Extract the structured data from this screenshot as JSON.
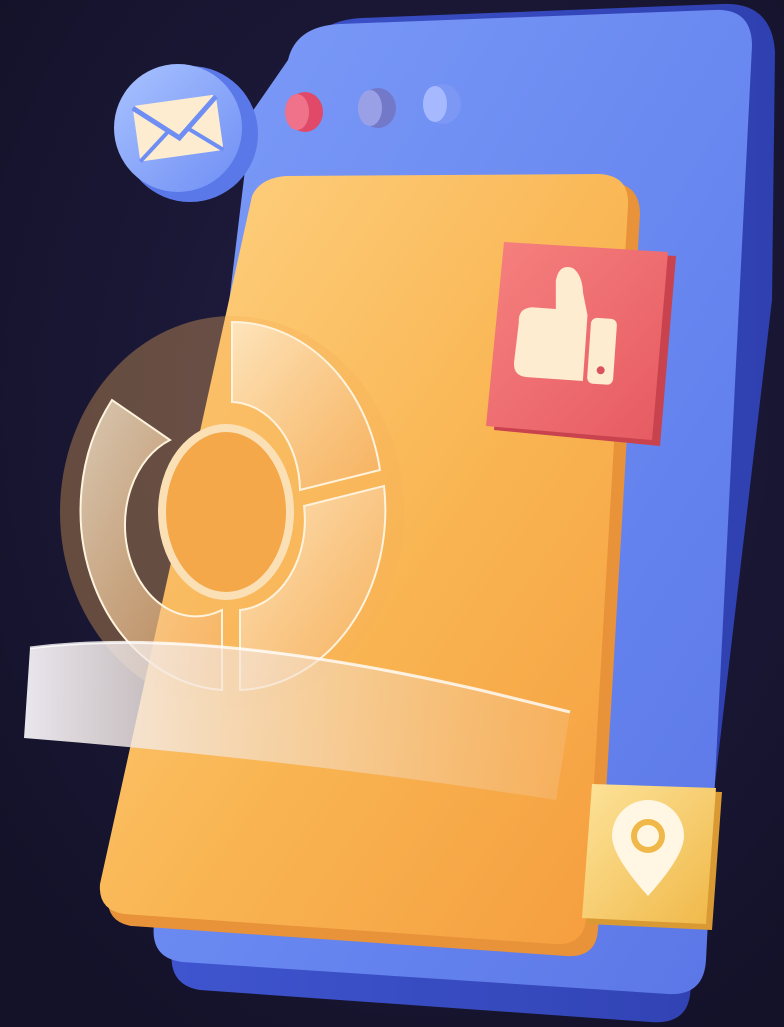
{
  "scene": {
    "kind": "3d-illustration",
    "subject": "phone",
    "colors": {
      "background": "#17142e",
      "phone_blue": "#6b8cf4",
      "phone_blue_dark": "#3d53c9",
      "screen_orange": "#f6b04e",
      "like_red": "#ee6a6c",
      "pin_yellow": "#f4c45c",
      "cream": "#fdeccf"
    },
    "icons": [
      "mail-icon",
      "thumbs-up-icon",
      "location-pin-icon",
      "donut-chart-icon"
    ],
    "dots": [
      "#e54866",
      "#7f86d6",
      "#8aa3ff"
    ]
  }
}
